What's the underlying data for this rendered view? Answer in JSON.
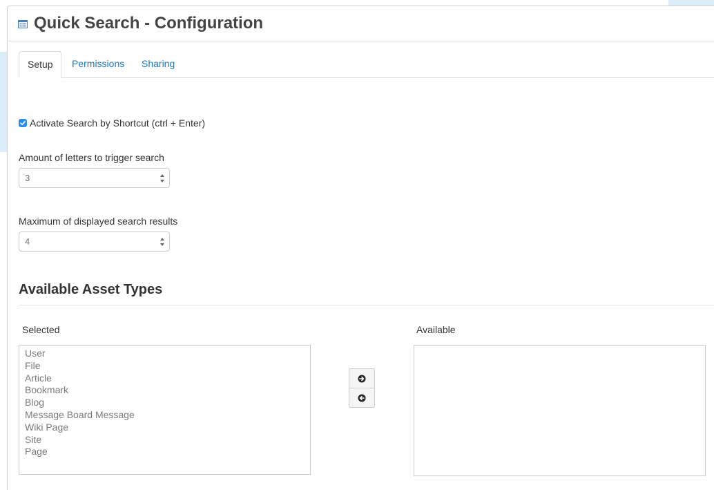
{
  "header": {
    "title": "Quick Search - Configuration",
    "icon": "panel-icon"
  },
  "tabs": [
    {
      "label": "Setup",
      "active": true
    },
    {
      "label": "Permissions",
      "active": false
    },
    {
      "label": "Sharing",
      "active": false
    }
  ],
  "setup": {
    "shortcut_checkbox": {
      "label": "Activate Search by Shortcut (ctrl + Enter)",
      "checked": true
    },
    "letters_trigger": {
      "label": "Amount of letters to trigger search",
      "value": "3"
    },
    "max_results": {
      "label": "Maximum of displayed search results",
      "value": "4"
    }
  },
  "asset_types": {
    "section_title": "Available Asset Types",
    "selected_label": "Selected",
    "available_label": "Available",
    "selected_items": [
      "User",
      "File",
      "Article",
      "Bookmark",
      "Blog",
      "Message Board Message",
      "Wiki Page",
      "Site",
      "Page"
    ],
    "available_items": [],
    "move_right_icon": "arrow-right-circle-icon",
    "move_left_icon": "arrow-left-circle-icon"
  },
  "colors": {
    "accent": "#1a7abf",
    "checkbox": "#2e8ee6",
    "backdrop": "#d9ecf8"
  }
}
